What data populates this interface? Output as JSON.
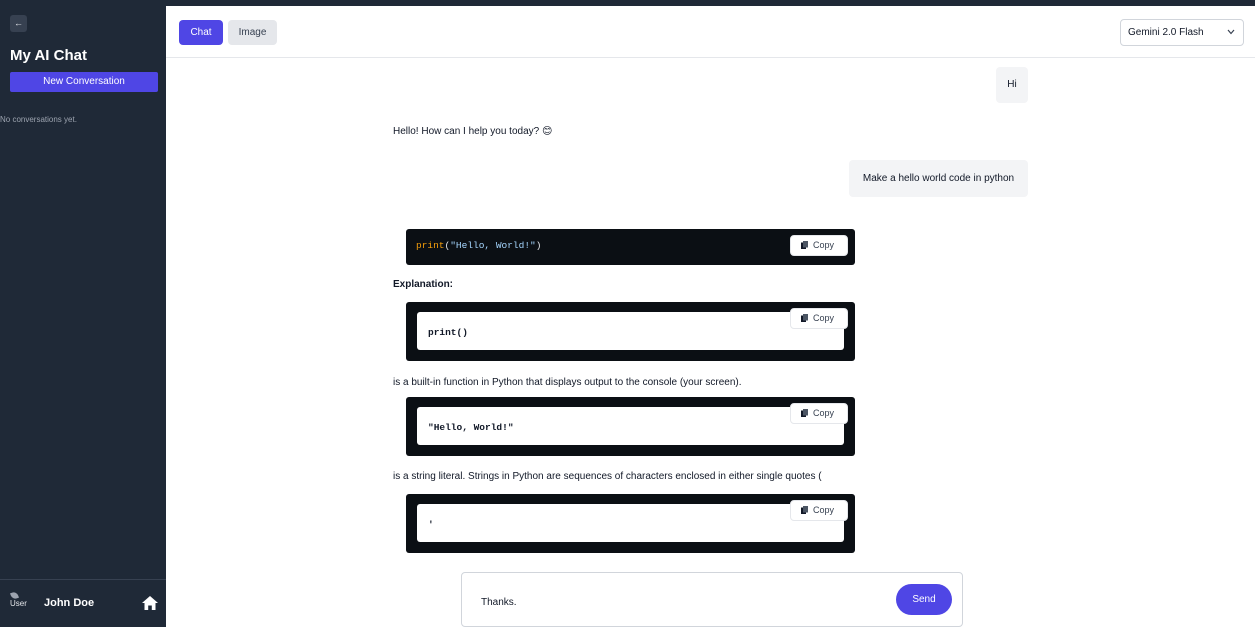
{
  "app": {
    "title": "My AI Chat",
    "collapse_glyph": "←",
    "new_conversation": "New Conversation",
    "empty_state": "No conversations yet."
  },
  "user": {
    "avatar_alt": "User",
    "name": "John Doe"
  },
  "header": {
    "tabs": [
      {
        "label": "Chat",
        "active": true
      },
      {
        "label": "Image",
        "active": false
      }
    ],
    "model": "Gemini 2.0 Flash"
  },
  "messages": {
    "user_hi": "Hi",
    "ai_hello": "Hello! How can I help you today? 😊",
    "user_make": "Make a hello world code in python",
    "code1": {
      "fn": "print",
      "open": "(",
      "str": "\"Hello, World!\"",
      "close": ")"
    },
    "explanation": "Explanation:",
    "code2": "print()",
    "builtin_text": "is a built-in function in Python that displays output to the console (your screen).",
    "code3": "\"Hello, World!\"",
    "string_text": "is a string literal. Strings in Python are sequences of characters enclosed in either single quotes (",
    "code4": "'",
    "copy_label": "Copy"
  },
  "composer": {
    "value": "Thanks.",
    "send_label": "Send"
  },
  "colors": {
    "accent": "#4f46e5",
    "sidebar": "#1f2937",
    "code_bg": "#0b0f14"
  }
}
